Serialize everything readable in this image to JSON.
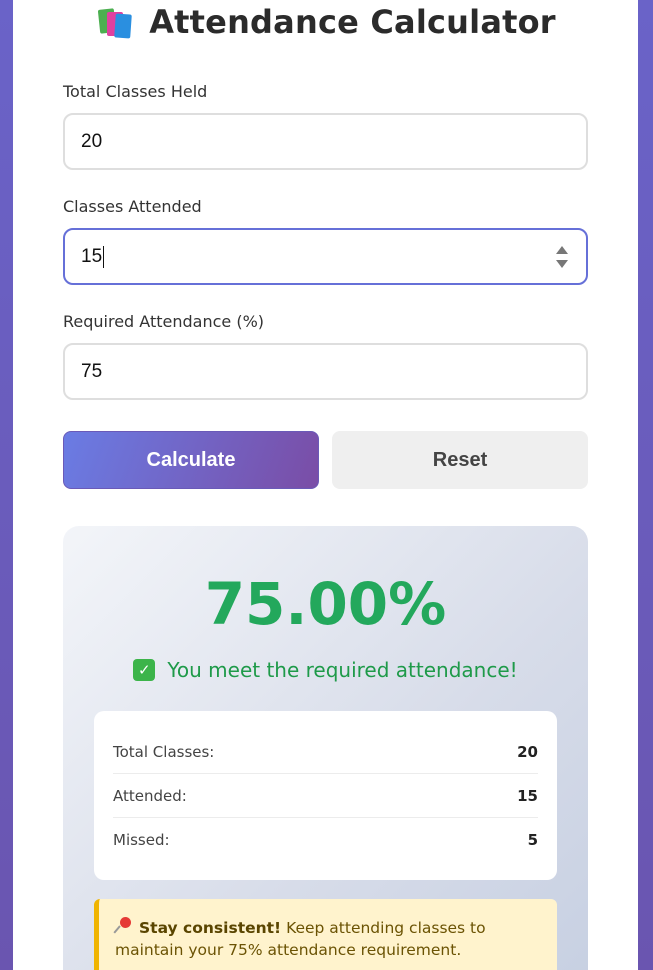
{
  "title": "Attendance Calculator",
  "title_icon": "books-icon",
  "fields": {
    "total": {
      "label": "Total Classes Held",
      "value": "20"
    },
    "attended": {
      "label": "Classes Attended",
      "value": "15"
    },
    "required": {
      "label": "Required Attendance (%)",
      "value": "75"
    }
  },
  "buttons": {
    "calculate": "Calculate",
    "reset": "Reset"
  },
  "result": {
    "percentage": "75.00%",
    "message": "You meet the required attendance!",
    "message_icon": "check-icon",
    "stats": [
      {
        "label": "Total Classes:",
        "value": "20"
      },
      {
        "label": "Attended:",
        "value": "15"
      },
      {
        "label": "Missed:",
        "value": "5"
      }
    ],
    "tip": {
      "icon": "pin-icon",
      "bold": "Stay consistent!",
      "text": " Keep attending classes to maintain your 75% attendance requirement."
    }
  },
  "colors": {
    "accent_start": "#6a7ce4",
    "accent_end": "#7a4da6",
    "success": "#23a85c",
    "tip_border": "#f0b400"
  }
}
